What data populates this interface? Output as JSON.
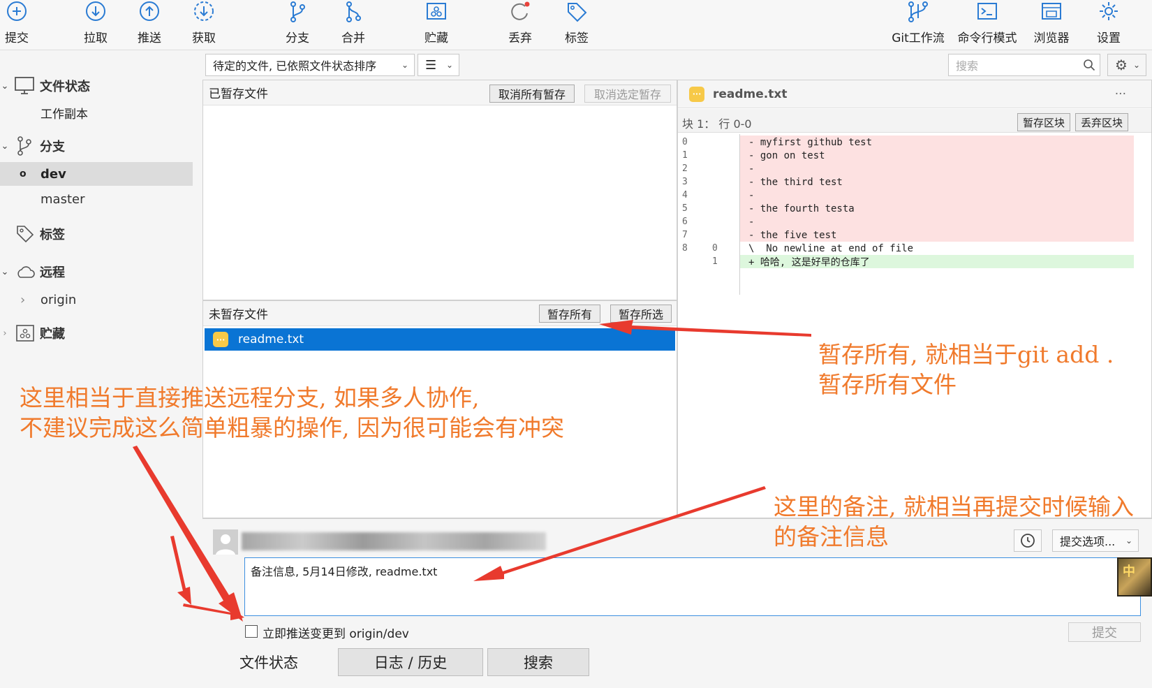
{
  "toolbar": {
    "commit": "提交",
    "pull": "拉取",
    "push": "推送",
    "fetch": "获取",
    "branch": "分支",
    "merge": "合并",
    "stash": "贮藏",
    "discard": "丢弃",
    "tag": "标签",
    "gitflow": "Git工作流",
    "terminal": "命令行模式",
    "browser": "浏览器",
    "settings": "设置"
  },
  "sidebar": {
    "file_status": "文件状态",
    "working_copy": "工作副本",
    "branches": "分支",
    "branch_dev": "dev",
    "branch_master": "master",
    "tags": "标签",
    "remotes": "远程",
    "remote_origin": "origin",
    "stashes": "贮藏"
  },
  "filter": {
    "sort_mode": "待定的文件, 已依照文件状态排序",
    "search_placeholder": "搜索"
  },
  "staged": {
    "title": "已暂存文件",
    "unstage_all": "取消所有暂存",
    "unstage_selected": "取消选定暂存"
  },
  "unstaged": {
    "title": "未暂存文件",
    "stage_all": "暂存所有",
    "stage_selected": "暂存所选",
    "files": [
      "readme.txt"
    ]
  },
  "diff": {
    "filename": "readme.txt",
    "more": "···",
    "hunk_header": "块 1： 行 0-0",
    "stage_hunk": "暂存区块",
    "discard_hunk": "丢弃区块",
    "lines": [
      {
        "old": "0",
        "new": "",
        "text": "- myfirst github test",
        "kind": "del"
      },
      {
        "old": "1",
        "new": "",
        "text": "- gon on test",
        "kind": "del"
      },
      {
        "old": "2",
        "new": "",
        "text": "-",
        "kind": "del"
      },
      {
        "old": "3",
        "new": "",
        "text": "- the third test",
        "kind": "del"
      },
      {
        "old": "4",
        "new": "",
        "text": "-",
        "kind": "del"
      },
      {
        "old": "5",
        "new": "",
        "text": "- the fourth testa",
        "kind": "del"
      },
      {
        "old": "6",
        "new": "",
        "text": "-",
        "kind": "del"
      },
      {
        "old": "7",
        "new": "",
        "text": "- the five test",
        "kind": "del"
      },
      {
        "old": "8",
        "new": "0",
        "text": "\\  No newline at end of file",
        "kind": "ctx"
      },
      {
        "old": "",
        "new": "1",
        "text": "+ 哈哈, 这是好早的仓库了",
        "kind": "add"
      }
    ]
  },
  "commit": {
    "message": "备注信息, 5月14日修改, readme.txt",
    "options": "提交选项...",
    "push_immediately": "立即推送变更到 origin/dev",
    "submit": "提交",
    "ime": "中"
  },
  "tabs": {
    "file_status": "文件状态",
    "log_history": "日志 / 历史",
    "search": "搜索"
  },
  "annotations": {
    "stage_all_line1": "暂存所有, 就相当于git add .",
    "stage_all_line2": "暂存所有文件",
    "push_line1": "这里相当于直接推送远程分支, 如果多人协作,",
    "push_line2": "不建议完成这么简单粗暴的操作, 因为很可能会有冲突",
    "note_line1": "这里的备注, 就相当再提交时候输入",
    "note_line2": "的备注信息"
  },
  "colors": {
    "accent": "#0a74d4",
    "annotation": "#f07a2c",
    "arrow": "#e83a2e",
    "diff_del_bg": "#fde1e1",
    "diff_add_bg": "#ddf7dd"
  }
}
